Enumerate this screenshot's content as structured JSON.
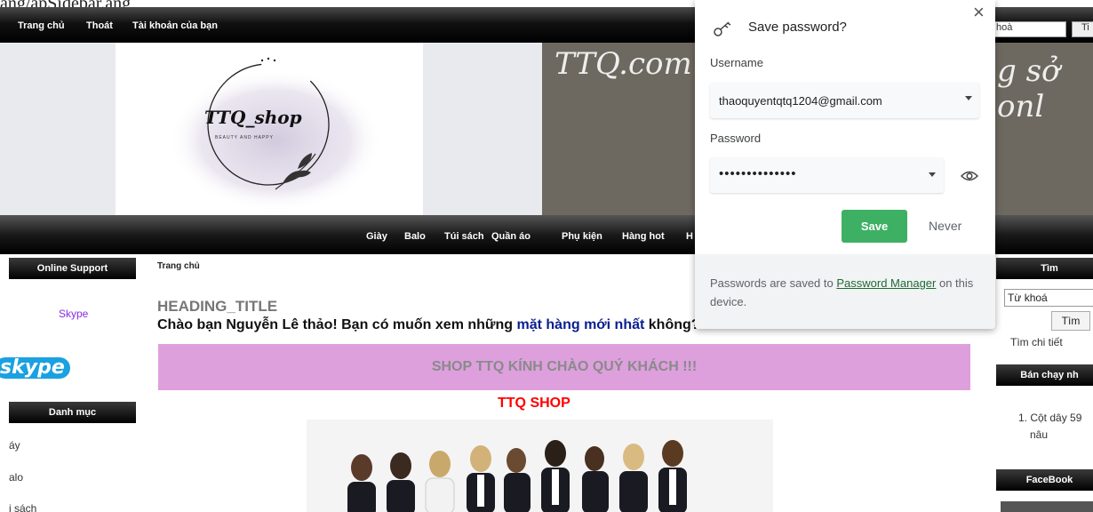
{
  "browser": {
    "url_fragment": "ang/apSidebar.ang"
  },
  "topnav": {
    "items": [
      "Trang chủ",
      "Thoát",
      "Tài khoản của bạn"
    ],
    "search_value": "hoà",
    "search_button": "Ti"
  },
  "banner": {
    "logo_text": "TTQ_shop",
    "logo_tagline": "BEAUTY AND HAPPY",
    "script_left": "TTQ.com",
    "script_right": "g sở onl"
  },
  "categories": [
    "Giày",
    "Balo",
    "Túi sách",
    "Quần áo",
    "Phụ kiện",
    "Hàng hot",
    "H"
  ],
  "left_sidebar": {
    "online_support": "Online Support",
    "skype_label": "Skype",
    "skype_logo": "skype",
    "danh_muc": "Danh mục",
    "items": [
      "áy",
      "alo",
      "i sách"
    ]
  },
  "main": {
    "breadcrumb": "Trang chủ",
    "heading_title": "HEADING_TITLE",
    "welcome_prefix": "Chào bạn Nguyễn Lê thảo! Bạn có muốn xem những ",
    "welcome_link": "mặt hàng mới nhất",
    "welcome_suffix": " không?",
    "shop_banner": "SHOP TTQ KÍNH CHÀO QUÝ KHÁCH !!!",
    "shop_title": "TTQ SHOP"
  },
  "right_sidebar": {
    "tim_head": "Tìm",
    "keyword_value": "Từ khoá",
    "tim_button": "Tìm",
    "detail": "Tìm chi tiết",
    "best_head": "Bán chạy nh",
    "best_item_line1": "1. Cột dây 59",
    "best_item_line2": "nâu",
    "facebook_head": "FaceBook"
  },
  "password_popup": {
    "icon": "key-icon",
    "title": "Save password?",
    "close": "×",
    "username_label": "Username",
    "username_value": "thaoquyentqtq1204@gmail.com",
    "password_label": "Password",
    "password_value": "••••••••••••••",
    "save_button": "Save",
    "never_button": "Never",
    "footer_prefix": "Passwords are saved to ",
    "footer_link": "Password Manager",
    "footer_suffix": " on this device.",
    "accent_color": "#3eb064"
  }
}
